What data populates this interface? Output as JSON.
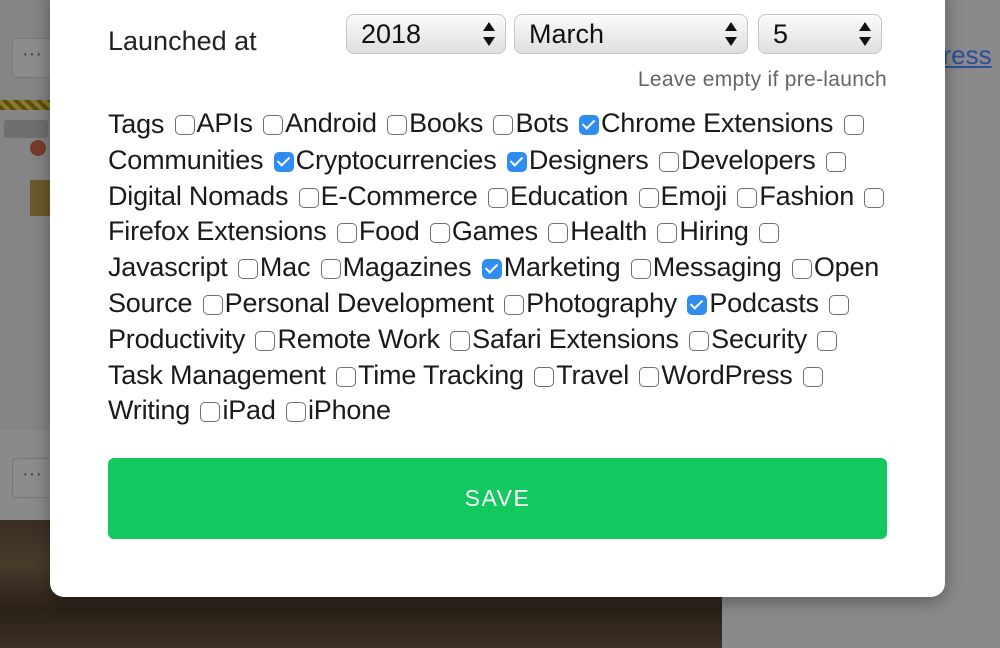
{
  "background": {
    "right_link": "gress"
  },
  "form": {
    "launched_label": "Launched at",
    "year": "2018",
    "month": "March",
    "day": "5",
    "hint": "Leave empty if pre-launch",
    "tags_label": "Tags",
    "tags": [
      {
        "label": "APIs",
        "checked": false
      },
      {
        "label": "Android",
        "checked": false
      },
      {
        "label": "Books",
        "checked": false
      },
      {
        "label": "Bots",
        "checked": false
      },
      {
        "label": "Chrome Extensions",
        "checked": true
      },
      {
        "label": "Communities",
        "checked": false
      },
      {
        "label": "Cryptocurrencies",
        "checked": true
      },
      {
        "label": "Designers",
        "checked": true
      },
      {
        "label": "Developers",
        "checked": false
      },
      {
        "label": "Digital Nomads",
        "checked": false
      },
      {
        "label": "E-Commerce",
        "checked": false
      },
      {
        "label": "Education",
        "checked": false
      },
      {
        "label": "Emoji",
        "checked": false
      },
      {
        "label": "Fashion",
        "checked": false
      },
      {
        "label": "Firefox Extensions",
        "checked": false
      },
      {
        "label": "Food",
        "checked": false
      },
      {
        "label": "Games",
        "checked": false
      },
      {
        "label": "Health",
        "checked": false
      },
      {
        "label": "Hiring",
        "checked": false
      },
      {
        "label": "Javascript",
        "checked": false
      },
      {
        "label": "Mac",
        "checked": false
      },
      {
        "label": "Magazines",
        "checked": false
      },
      {
        "label": "Marketing",
        "checked": true
      },
      {
        "label": "Messaging",
        "checked": false
      },
      {
        "label": "Open Source",
        "checked": false
      },
      {
        "label": "Personal Development",
        "checked": false
      },
      {
        "label": "Photography",
        "checked": false
      },
      {
        "label": "Podcasts",
        "checked": true
      },
      {
        "label": "Productivity",
        "checked": false
      },
      {
        "label": "Remote Work",
        "checked": false
      },
      {
        "label": "Safari Extensions",
        "checked": false
      },
      {
        "label": "Security",
        "checked": false
      },
      {
        "label": "Task Management",
        "checked": false
      },
      {
        "label": "Time Tracking",
        "checked": false
      },
      {
        "label": "Travel",
        "checked": false
      },
      {
        "label": "WordPress",
        "checked": false
      },
      {
        "label": "Writing",
        "checked": false
      },
      {
        "label": "iPad",
        "checked": false
      },
      {
        "label": "iPhone",
        "checked": false
      }
    ],
    "save_label": "SAVE"
  },
  "colors": {
    "save_button": "#11c95e",
    "checkbox_checked": "#2f8cf1"
  }
}
